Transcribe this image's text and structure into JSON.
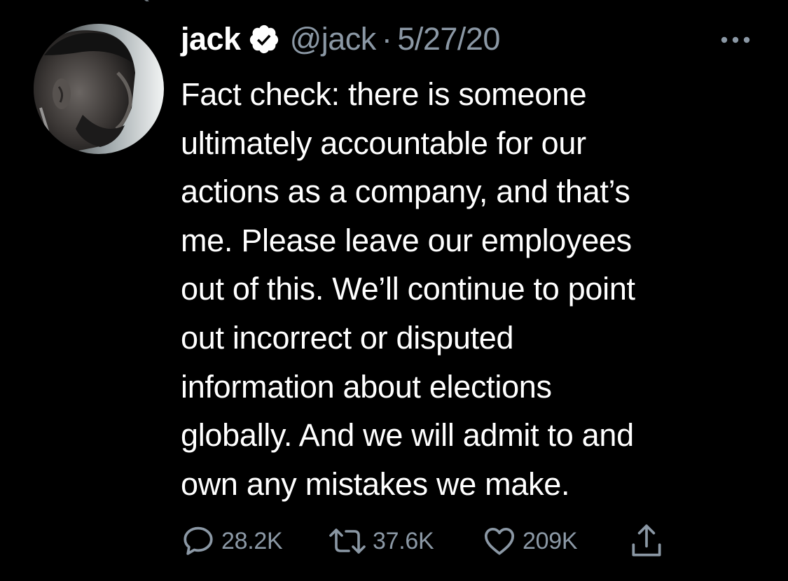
{
  "tweet": {
    "author": {
      "display_name": "jack",
      "handle": "@jack",
      "verified": true
    },
    "separator": "·",
    "timestamp": "5/27/20",
    "text_lines": [
      "Fact check: there is someone",
      "ultimately accountable for our",
      "actions as a company, and that’s",
      "me. Please leave our employees",
      "out of this. We’ll continue to point",
      "out incorrect or disputed",
      "information about elections",
      "globally. And we will admit to and",
      "own any mistakes we make."
    ],
    "stats": {
      "replies": "28.2K",
      "retweets": "37.6K",
      "likes": "209K"
    }
  },
  "icons": {
    "more": "more-horizontal-icon",
    "verified": "verified-badge-icon",
    "reply": "reply-icon",
    "retweet": "retweet-icon",
    "like": "heart-icon",
    "share": "share-icon"
  },
  "colors": {
    "background": "#000000",
    "text": "#ffffff",
    "secondary_text": "#8b98a5",
    "icon": "#8b98a5"
  }
}
